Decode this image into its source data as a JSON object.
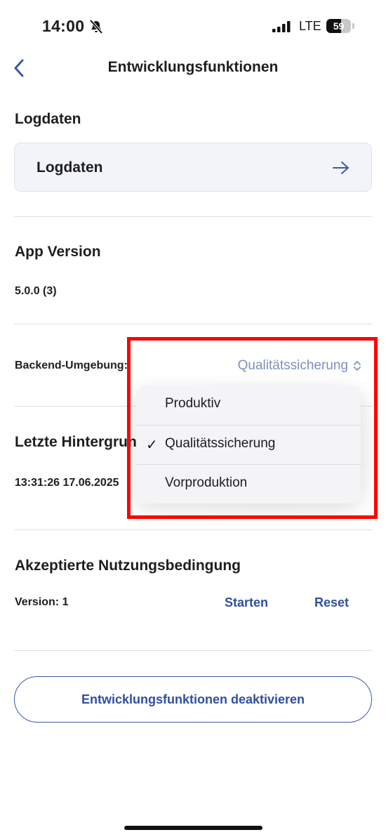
{
  "status_bar": {
    "time": "14:00",
    "network": "LTE",
    "battery": "59",
    "battery_level": 0.59
  },
  "header": {
    "title": "Entwicklungsfunktionen"
  },
  "logdaten": {
    "section_title": "Logdaten",
    "card_label": "Logdaten"
  },
  "app_version": {
    "section_title": "App Version",
    "value": "5.0.0 (3)"
  },
  "backend": {
    "label": "Backend-Umgebung:",
    "selected": "Qualitätssicherung"
  },
  "background": {
    "section_title": "Letzte Hintergrun",
    "value": "13:31:26 17.06.2025"
  },
  "terms": {
    "section_title": "Akzeptierte Nutzungsbedingung",
    "version": "Version: 1",
    "start_label": "Starten",
    "reset_label": "Reset"
  },
  "deactivate_label": "Entwicklungsfunktionen deaktivieren",
  "menu": {
    "items": [
      {
        "label": "Produktiv",
        "checked": false
      },
      {
        "label": "Qualitätssicherung",
        "checked": true
      },
      {
        "label": "Vorproduktion",
        "checked": false
      }
    ],
    "check_glyph": "✓"
  },
  "colors": {
    "accent": "#2f4fa0",
    "highlight": "#ff0000"
  }
}
